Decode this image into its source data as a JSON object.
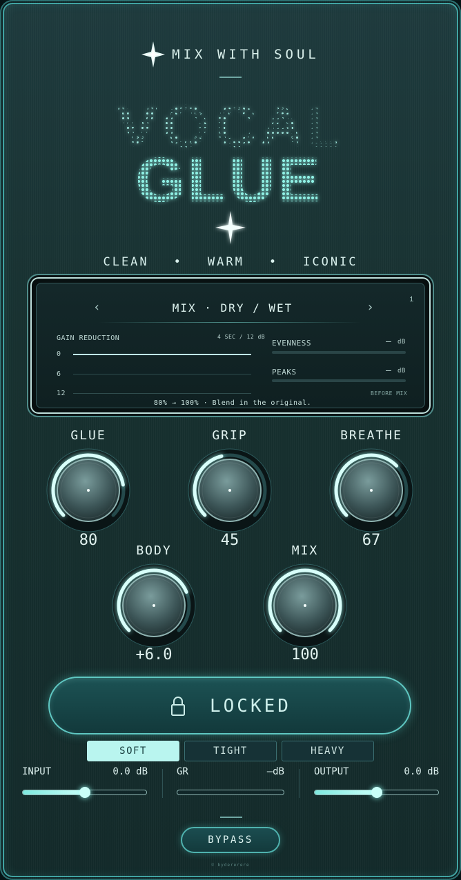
{
  "brand": {
    "text": "MIX WITH SOUL",
    "icon": "sparkle-star-icon"
  },
  "title": {
    "line1": "VOCAL",
    "line2": "GLUE"
  },
  "tagline": [
    "CLEAN",
    "•",
    "WARM",
    "•",
    "ICONIC"
  ],
  "screen": {
    "mode": "MIX · DRY / WET",
    "prev_icon": "chevron-left-icon",
    "next_icon": "chevron-right-icon",
    "info": "i",
    "gain_reduction_label": "GAIN REDUCTION",
    "window": "4 SEC / 12 dB",
    "scale": [
      "0",
      "6",
      "12"
    ],
    "evenness_label": "EVENNESS",
    "evenness_value": "—",
    "evenness_unit": "dB",
    "peaks_label": "PEAKS",
    "peaks_value": "—",
    "peaks_unit": "dB",
    "before_mix": "BEFORE MIX",
    "hint": "80% → 100% · Blend in the original."
  },
  "knobs": [
    {
      "label": "GLUE",
      "value": "80",
      "level": 0.8
    },
    {
      "label": "GRIP",
      "value": "45",
      "level": 0.45
    },
    {
      "label": "BREATHE",
      "value": "67",
      "level": 0.67
    },
    {
      "label": "BODY",
      "value": "+6.0",
      "level": 0.75
    },
    {
      "label": "MIX",
      "value": "100",
      "level": 1.0
    }
  ],
  "locked_button": {
    "label": "LOCKED",
    "icon": "lock-icon"
  },
  "modes": [
    {
      "label": "SOFT",
      "active": true
    },
    {
      "label": "TIGHT",
      "active": false
    },
    {
      "label": "HEAVY",
      "active": false
    }
  ],
  "meters": {
    "input": {
      "label": "INPUT",
      "value": "0.0 dB",
      "level": 0.5
    },
    "gr": {
      "label": "GR",
      "value": "—dB",
      "level": 0.0
    },
    "output": {
      "label": "OUTPUT",
      "value": "0.0 dB",
      "level": 0.5
    }
  },
  "bypass": {
    "label": "BYPASS"
  },
  "credit": "© bydererere",
  "colors": {
    "accent": "#7ee9df",
    "panel": "#17302f",
    "screen": "#0f2021",
    "active_segment": "#b9f5ef"
  }
}
